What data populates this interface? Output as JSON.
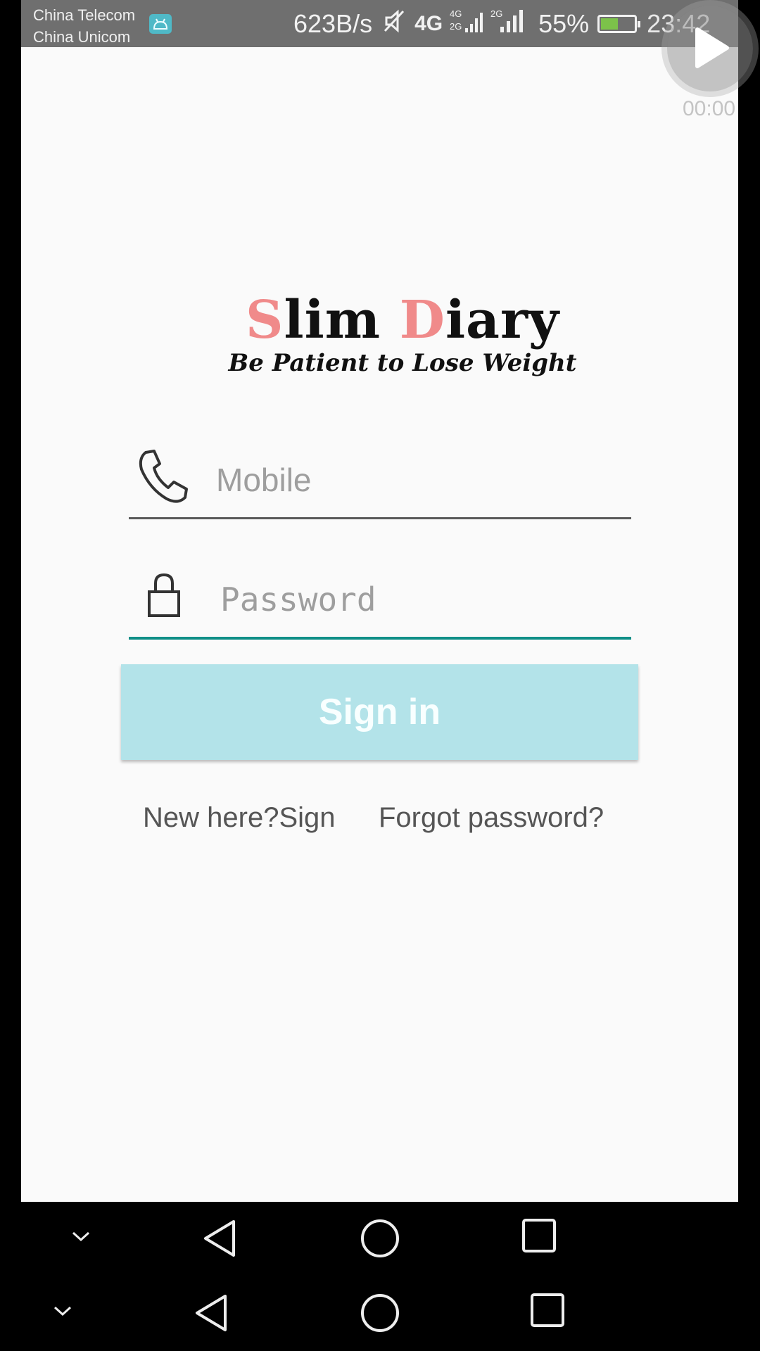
{
  "status_bar": {
    "carrier_1": "China Telecom",
    "carrier_2": "China Unicom",
    "net_speed": "623B/s",
    "network_1": "4G",
    "network_2": "4G 2G",
    "network_3": "2G",
    "battery_percent": "55%",
    "battery_level": 0.55,
    "time": "23:42"
  },
  "recorder": {
    "time": "00:00",
    "icon": "play-icon"
  },
  "logo": {
    "title_accent_1": "S",
    "title_part_1": "lim ",
    "title_accent_2": "D",
    "title_part_2": "iary",
    "tagline": "Be Patient to Lose Weight",
    "accent_color": "#f08a8a"
  },
  "form": {
    "mobile_placeholder": "Mobile",
    "mobile_icon": "phone-icon",
    "password_placeholder": "Password",
    "password_icon": "lock-icon",
    "focus_color": "#108f87",
    "signin_label": "Sign in",
    "signin_color": "#b3e3e9"
  },
  "links": {
    "new_here": "New here?Sign",
    "forgot": "Forgot password?"
  },
  "nav": {
    "icons": [
      "chevron-down-icon",
      "back-icon",
      "home-icon",
      "recents-icon"
    ]
  }
}
